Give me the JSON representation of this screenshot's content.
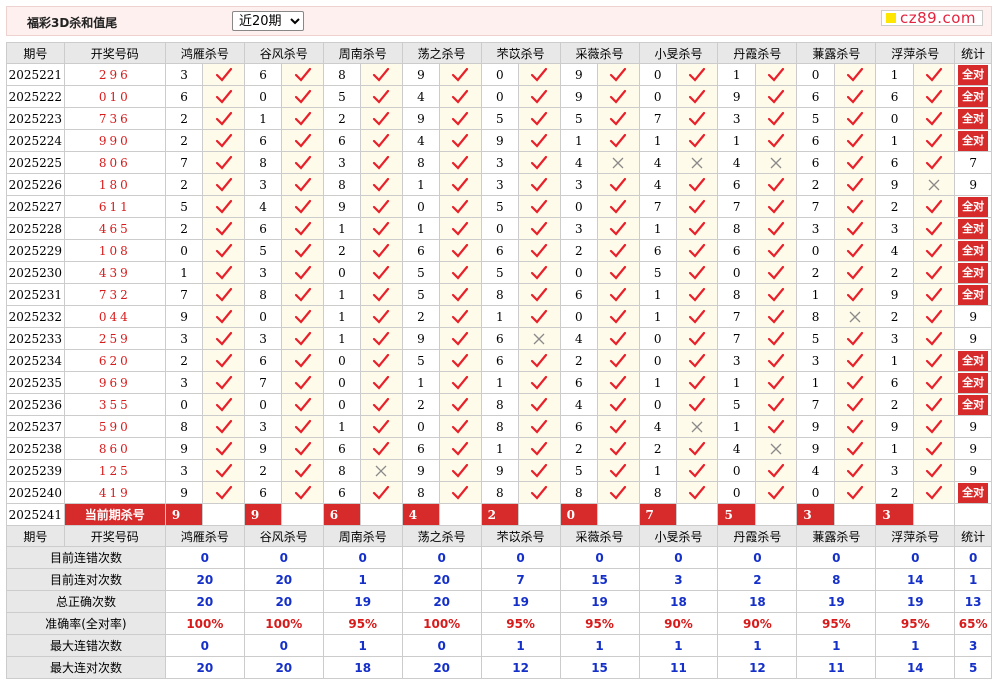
{
  "header": {
    "title": "福彩3D杀和值尾",
    "period_selected": "近20期",
    "period_options": [
      "近20期"
    ],
    "logo": "cz89.com",
    "colors": {
      "accent": "#d72a2a",
      "blue": "#1530c8"
    }
  },
  "columns": {
    "period": "期号",
    "draw": "开奖号码",
    "experts": [
      "鸿雁杀号",
      "谷风杀号",
      "周南杀号",
      "荡之杀号",
      "芣苡杀号",
      "采薇杀号",
      "小旻杀号",
      "丹霞杀号",
      "蒹露杀号",
      "浮萍杀号"
    ],
    "stat": "统计"
  },
  "rows": [
    {
      "p": "2025221",
      "d": "296",
      "n": [
        3,
        6,
        8,
        9,
        0,
        9,
        0,
        1,
        0,
        1
      ],
      "r": [
        1,
        1,
        1,
        1,
        1,
        1,
        1,
        1,
        1,
        1
      ],
      "s": "全对"
    },
    {
      "p": "2025222",
      "d": "010",
      "n": [
        6,
        0,
        5,
        4,
        0,
        9,
        0,
        9,
        6,
        6
      ],
      "r": [
        1,
        1,
        1,
        1,
        1,
        1,
        1,
        1,
        1,
        1
      ],
      "s": "全对"
    },
    {
      "p": "2025223",
      "d": "736",
      "n": [
        2,
        1,
        2,
        9,
        5,
        5,
        7,
        3,
        5,
        0
      ],
      "r": [
        1,
        1,
        1,
        1,
        1,
        1,
        1,
        1,
        1,
        1
      ],
      "s": "全对"
    },
    {
      "p": "2025224",
      "d": "990",
      "n": [
        2,
        6,
        6,
        4,
        9,
        1,
        1,
        1,
        6,
        1
      ],
      "r": [
        1,
        1,
        1,
        1,
        1,
        1,
        1,
        1,
        1,
        1
      ],
      "s": "全对"
    },
    {
      "p": "2025225",
      "d": "806",
      "n": [
        7,
        8,
        3,
        8,
        3,
        4,
        4,
        4,
        6,
        6
      ],
      "r": [
        1,
        1,
        1,
        1,
        1,
        0,
        0,
        0,
        1,
        1
      ],
      "s": "7"
    },
    {
      "p": "2025226",
      "d": "180",
      "n": [
        2,
        3,
        8,
        1,
        3,
        3,
        4,
        6,
        2,
        9
      ],
      "r": [
        1,
        1,
        1,
        1,
        1,
        1,
        1,
        1,
        1,
        0
      ],
      "s": "9"
    },
    {
      "p": "2025227",
      "d": "611",
      "n": [
        5,
        4,
        9,
        0,
        5,
        0,
        7,
        7,
        7,
        2
      ],
      "r": [
        1,
        1,
        1,
        1,
        1,
        1,
        1,
        1,
        1,
        1
      ],
      "s": "全对"
    },
    {
      "p": "2025228",
      "d": "465",
      "n": [
        2,
        6,
        1,
        1,
        0,
        3,
        1,
        8,
        3,
        3
      ],
      "r": [
        1,
        1,
        1,
        1,
        1,
        1,
        1,
        1,
        1,
        1
      ],
      "s": "全对"
    },
    {
      "p": "2025229",
      "d": "108",
      "n": [
        0,
        5,
        2,
        6,
        6,
        2,
        6,
        6,
        0,
        4
      ],
      "r": [
        1,
        1,
        1,
        1,
        1,
        1,
        1,
        1,
        1,
        1
      ],
      "s": "全对"
    },
    {
      "p": "2025230",
      "d": "439",
      "n": [
        1,
        3,
        0,
        5,
        5,
        0,
        5,
        0,
        2,
        2
      ],
      "r": [
        1,
        1,
        1,
        1,
        1,
        1,
        1,
        1,
        1,
        1
      ],
      "s": "全对"
    },
    {
      "p": "2025231",
      "d": "732",
      "n": [
        7,
        8,
        1,
        5,
        8,
        6,
        1,
        8,
        1,
        9
      ],
      "r": [
        1,
        1,
        1,
        1,
        1,
        1,
        1,
        1,
        1,
        1
      ],
      "s": "全对"
    },
    {
      "p": "2025232",
      "d": "044",
      "n": [
        9,
        0,
        1,
        2,
        1,
        0,
        1,
        7,
        8,
        2
      ],
      "r": [
        1,
        1,
        1,
        1,
        1,
        1,
        1,
        1,
        0,
        1
      ],
      "s": "9"
    },
    {
      "p": "2025233",
      "d": "259",
      "n": [
        3,
        3,
        1,
        9,
        6,
        4,
        0,
        7,
        5,
        3
      ],
      "r": [
        1,
        1,
        1,
        1,
        0,
        1,
        1,
        1,
        1,
        1
      ],
      "s": "9"
    },
    {
      "p": "2025234",
      "d": "620",
      "n": [
        2,
        6,
        0,
        5,
        6,
        2,
        0,
        3,
        3,
        1
      ],
      "r": [
        1,
        1,
        1,
        1,
        1,
        1,
        1,
        1,
        1,
        1
      ],
      "s": "全对"
    },
    {
      "p": "2025235",
      "d": "969",
      "n": [
        3,
        7,
        0,
        1,
        1,
        6,
        1,
        1,
        1,
        6
      ],
      "r": [
        1,
        1,
        1,
        1,
        1,
        1,
        1,
        1,
        1,
        1
      ],
      "s": "全对"
    },
    {
      "p": "2025236",
      "d": "355",
      "n": [
        0,
        0,
        0,
        2,
        8,
        4,
        0,
        5,
        7,
        2
      ],
      "r": [
        1,
        1,
        1,
        1,
        1,
        1,
        1,
        1,
        1,
        1
      ],
      "s": "全对"
    },
    {
      "p": "2025237",
      "d": "590",
      "n": [
        8,
        3,
        1,
        0,
        8,
        6,
        4,
        1,
        9,
        9
      ],
      "r": [
        1,
        1,
        1,
        1,
        1,
        1,
        0,
        1,
        1,
        1
      ],
      "s": "9"
    },
    {
      "p": "2025238",
      "d": "860",
      "n": [
        9,
        9,
        6,
        6,
        1,
        2,
        2,
        4,
        9,
        1
      ],
      "r": [
        1,
        1,
        1,
        1,
        1,
        1,
        1,
        0,
        1,
        1
      ],
      "s": "9"
    },
    {
      "p": "2025239",
      "d": "125",
      "n": [
        3,
        2,
        8,
        9,
        9,
        5,
        1,
        0,
        4,
        3
      ],
      "r": [
        1,
        1,
        0,
        1,
        1,
        1,
        1,
        1,
        1,
        1
      ],
      "s": "9"
    },
    {
      "p": "2025240",
      "d": "419",
      "n": [
        9,
        6,
        6,
        8,
        8,
        8,
        8,
        0,
        0,
        2
      ],
      "r": [
        1,
        1,
        1,
        1,
        1,
        1,
        1,
        1,
        1,
        1
      ],
      "s": "全对"
    }
  ],
  "current": {
    "period": "2025241",
    "label": "当前期杀号",
    "kills": [
      9,
      9,
      6,
      4,
      2,
      0,
      7,
      5,
      3,
      3
    ]
  },
  "footer_header": {
    "period": "期号",
    "draw": "开奖号码"
  },
  "stats": [
    {
      "label": "目前连错次数",
      "values": [
        "0",
        "0",
        "0",
        "0",
        "0",
        "0",
        "0",
        "0",
        "0",
        "0",
        "0"
      ],
      "red": false
    },
    {
      "label": "目前连对次数",
      "values": [
        "20",
        "20",
        "1",
        "20",
        "7",
        "15",
        "3",
        "2",
        "8",
        "14",
        "1"
      ],
      "red": false
    },
    {
      "label": "总正确次数",
      "values": [
        "20",
        "20",
        "19",
        "20",
        "19",
        "19",
        "18",
        "18",
        "19",
        "19",
        "13"
      ],
      "red": false
    },
    {
      "label": "准确率(全对率)",
      "values": [
        "100%",
        "100%",
        "95%",
        "100%",
        "95%",
        "95%",
        "90%",
        "90%",
        "95%",
        "95%",
        "65%"
      ],
      "red": true
    },
    {
      "label": "最大连错次数",
      "values": [
        "0",
        "0",
        "1",
        "0",
        "1",
        "1",
        "1",
        "1",
        "1",
        "1",
        "3"
      ],
      "red": false
    },
    {
      "label": "最大连对次数",
      "values": [
        "20",
        "20",
        "18",
        "20",
        "12",
        "15",
        "11",
        "12",
        "11",
        "14",
        "5"
      ],
      "red": false
    }
  ]
}
